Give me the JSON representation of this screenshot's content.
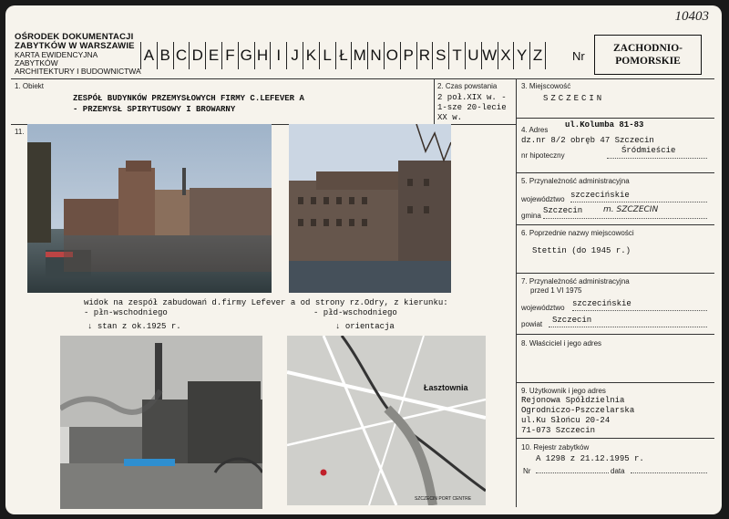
{
  "card_number": "10403",
  "institution": {
    "line1": "OŚRODEK DOKUMENTACJI",
    "line2": "ZABYTKÓW W WARSZAWIE",
    "line3": "KARTA EWIDENCYJNA ZABYTKÓW",
    "line4": "ARCHITEKTURY I BUDOWNICTWA"
  },
  "letters": [
    "A",
    "B",
    "C",
    "D",
    "E",
    "F",
    "G",
    "H",
    "I",
    "J",
    "K",
    "L",
    "Ł",
    "M",
    "N",
    "O",
    "P",
    "R",
    "S",
    "T",
    "U",
    "W",
    "X",
    "Y",
    "Z"
  ],
  "nr_label": "Nr",
  "region": {
    "line1": "ZACHODNIO-",
    "line2": "POMORSKIE"
  },
  "fields": {
    "obiekt": {
      "label": "1. Obiekt",
      "line1": "ZESPÓŁ BUDYNKÓW PRZEMYSŁOWYCH  FIRMY C.LEFEVER A",
      "line2": "- PRZEMYSŁ SPIRYTUSOWY I BROWARNY"
    },
    "czas": {
      "label": "2. Czas powstania",
      "line1": "2 poł.XIX w. -",
      "line2": "1-sze 20-lecie",
      "line3": "XX w."
    },
    "miejscowosc": {
      "label": "3. Miejscowość",
      "value": "SZCZECIN"
    },
    "adres": {
      "label": "4. Adres",
      "street": "ul.Kolumba 81-83",
      "dz": "dz.nr 8/2 obręb 47 Szczecin",
      "hip_label": "nr hipoteczny",
      "district": "Śródmieście"
    },
    "przynaleznosc": {
      "label": "5. Przynależność administracyjna",
      "woj_label": "województwo",
      "woj_value": "szczecińskie",
      "gmina_label": "gmina",
      "gmina_value": "Szczecin",
      "gmina_hand": "m. SZCZECIN"
    },
    "poprzednie": {
      "label": "6. Poprzednie nazwy miejscowości",
      "value": "Stettin (do 1945 r.)"
    },
    "przed1975": {
      "label1": "7. Przynależność administracyjna",
      "label2": "przed 1 VI 1975",
      "woj_label": "województwo",
      "woj_value": "szczecińskie",
      "powiat_label": "powiat",
      "powiat_value": "Szczecin"
    },
    "wlasciciel": {
      "label": "8. Właściciel i jego adres"
    },
    "uzytkownik": {
      "label": "9. Użytkownik i jego adres",
      "line1": "Rejonowa Spółdzielnia",
      "line2": "Ogrodniczo-Pszczelarska",
      "line3": "ul.Ku Słońcu 20-24",
      "line4": "71-073 Szczecin"
    },
    "rejestr": {
      "label": "10. Rejestr zabytków",
      "value": "A 1298 z 21.12.1995 r.",
      "nr_label": "Nr",
      "data_label": "data"
    }
  },
  "section11_label": "11.",
  "captions": {
    "view": "widok na zespół zabudowań d.firmy Lefever a od strony rz.Odry, z kierunku:",
    "left_dir": "- płn-wschodniego",
    "right_dir": "- płd-wschodniego",
    "hist": "stan z ok.1925 r.",
    "orient": "orientacja"
  },
  "map_labels": {
    "lasztownia": "Łasztownia",
    "port": "SZCZECIN PORT CENTRE"
  }
}
